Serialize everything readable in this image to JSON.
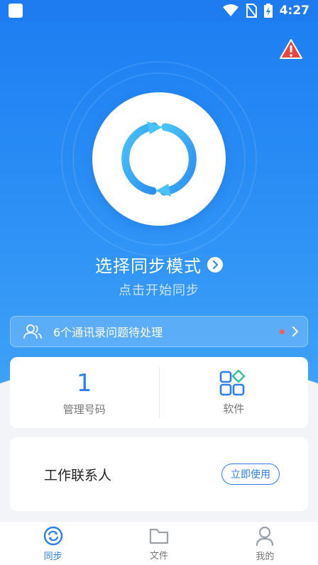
{
  "status_bar": {
    "time": "4:27"
  },
  "hero": {
    "mode_title": "选择同步模式",
    "mode_subtitle": "点击开始同步"
  },
  "notice": {
    "text": "6个通讯录问题待处理"
  },
  "stats": {
    "managed": {
      "value": "1",
      "label": "管理号码"
    },
    "software": {
      "label": "软件"
    }
  },
  "contacts_card": {
    "title": "工作联系人",
    "button_label": "立即使用"
  },
  "tabs": [
    {
      "label": "同步",
      "icon": "sync-icon",
      "active": true
    },
    {
      "label": "文件",
      "icon": "folder-icon",
      "active": false
    },
    {
      "label": "我的",
      "icon": "user-icon",
      "active": false
    }
  ],
  "colors": {
    "accent": "#2b7ff0",
    "hero_top": "#1e7ff2",
    "alert": "#e8453c"
  }
}
